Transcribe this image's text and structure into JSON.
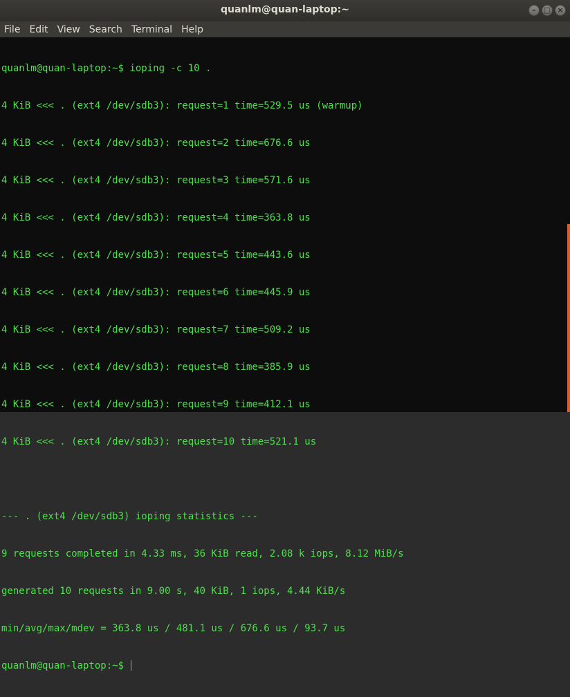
{
  "window": {
    "title": "quanlm@quan-laptop:~",
    "buttons": {
      "minimize": "–",
      "maximize": "□",
      "close": "×"
    }
  },
  "menu": [
    "File",
    "Edit",
    "View",
    "Search",
    "Terminal",
    "Help"
  ],
  "terminal": {
    "lines": [
      "quanlm@quan-laptop:~$ ioping -c 10 .",
      "4 KiB <<< . (ext4 /dev/sdb3): request=1 time=529.5 us (warmup)",
      "4 KiB <<< . (ext4 /dev/sdb3): request=2 time=676.6 us",
      "4 KiB <<< . (ext4 /dev/sdb3): request=3 time=571.6 us",
      "4 KiB <<< . (ext4 /dev/sdb3): request=4 time=363.8 us",
      "4 KiB <<< . (ext4 /dev/sdb3): request=5 time=443.6 us",
      "4 KiB <<< . (ext4 /dev/sdb3): request=6 time=445.9 us",
      "4 KiB <<< . (ext4 /dev/sdb3): request=7 time=509.2 us",
      "4 KiB <<< . (ext4 /dev/sdb3): request=8 time=385.9 us",
      "4 KiB <<< . (ext4 /dev/sdb3): request=9 time=412.1 us",
      "4 KiB <<< . (ext4 /dev/sdb3): request=10 time=521.1 us",
      "",
      "--- . (ext4 /dev/sdb3) ioping statistics ---",
      "9 requests completed in 4.33 ms, 36 KiB read, 2.08 k iops, 8.12 MiB/s",
      "generated 10 requests in 9.00 s, 40 KiB, 1 iops, 4.44 KiB/s",
      "min/avg/max/mdev = 363.8 us / 481.1 us / 676.6 us / 93.7 us"
    ],
    "prompt": "quanlm@quan-laptop:~$ ",
    "colors": {
      "text": "#4ce14b",
      "background": "#0d0d0d",
      "scroll_thumb": "#e05a2b"
    }
  }
}
